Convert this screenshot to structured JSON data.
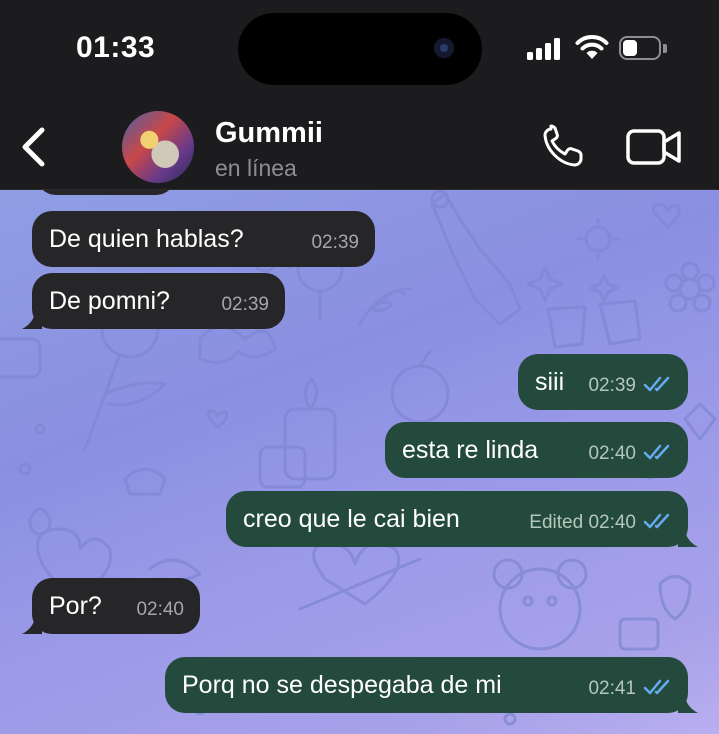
{
  "status_bar": {
    "time": "01:33"
  },
  "header": {
    "contact_name": "Gummii",
    "contact_status": "en línea",
    "back_icon": "chevron-left-icon",
    "call_icon": "phone-icon",
    "video_icon": "video-camera-icon"
  },
  "messages": [
    {
      "direction": "in",
      "text": "De quien hablas?",
      "time": "02:39"
    },
    {
      "direction": "in",
      "text": "De pomni?",
      "time": "02:39"
    },
    {
      "direction": "out",
      "text": "siii",
      "time": "02:39",
      "read": true
    },
    {
      "direction": "out",
      "text": "esta re linda",
      "time": "02:40",
      "read": true
    },
    {
      "direction": "out",
      "text": "creo que le cai bien",
      "time": "Edited 02:40",
      "read": true
    },
    {
      "direction": "in",
      "text": "Por?",
      "time": "02:40"
    },
    {
      "direction": "out",
      "text": "Porq no se despegaba de mi",
      "time": "02:41",
      "read": true
    }
  ],
  "colors": {
    "incoming_bubble": "#262628",
    "outgoing_bubble": "#234a3c",
    "read_ticks": "#66aaf0",
    "header_bg": "#1c1c1e",
    "wallpaper": "#9b9ae8"
  }
}
